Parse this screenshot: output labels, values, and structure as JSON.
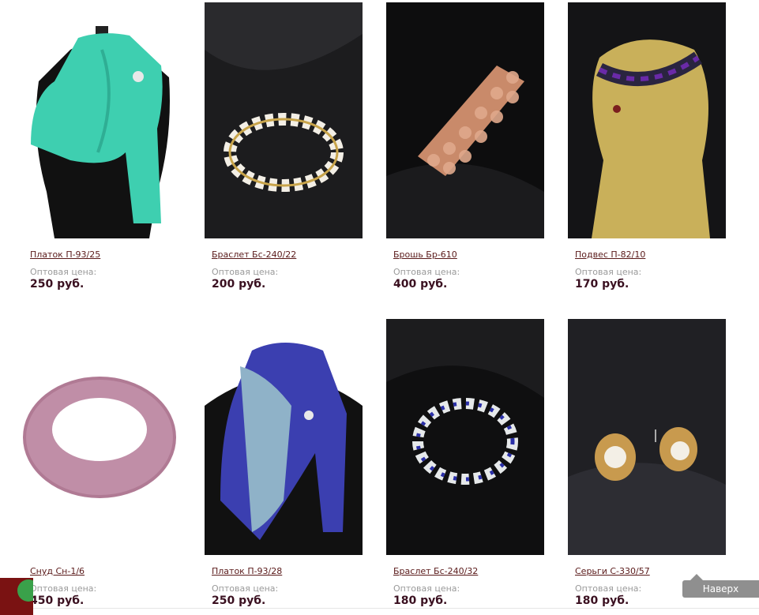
{
  "products": [
    {
      "title": "Платок П-93/25",
      "price_label": "Оптовая цена:",
      "price": "250 руб.",
      "image": "teal-scarf-on-mannequin"
    },
    {
      "title": "Браслет Бс-240/22",
      "price_label": "Оптовая цена:",
      "price": "200 руб.",
      "image": "pearl-bracelet"
    },
    {
      "title": "Брошь Бр-610",
      "price_label": "Оптовая цена:",
      "price": "400 руб.",
      "image": "copper-crystal-brooch"
    },
    {
      "title": "Подвес П-82/10",
      "price_label": "Оптовая цена:",
      "price": "170 руб.",
      "image": "lace-choker-on-bust"
    },
    {
      "title": "Снуд Сн-1/6",
      "price_label": "Оптовая цена:",
      "price": "450 руб.",
      "image": "pink-knit-snood"
    },
    {
      "title": "Платок П-93/28",
      "price_label": "Оптовая цена:",
      "price": "250 руб.",
      "image": "blue-scarf-on-mannequin"
    },
    {
      "title": "Браслет Бс-240/32",
      "price_label": "Оптовая цена:",
      "price": "180 руб.",
      "image": "pearl-blue-bracelet"
    },
    {
      "title": "Серьги С-330/57",
      "price_label": "Оптовая цена:",
      "price": "180 руб.",
      "image": "pearl-stud-earrings"
    }
  ],
  "scroll_top_label": "Наверх",
  "colors": {
    "title": "#5a1a1a",
    "price": "#3a1020",
    "label": "#9a9a9a",
    "top_button": "#8f8f8f",
    "widget": "#7a1212"
  }
}
